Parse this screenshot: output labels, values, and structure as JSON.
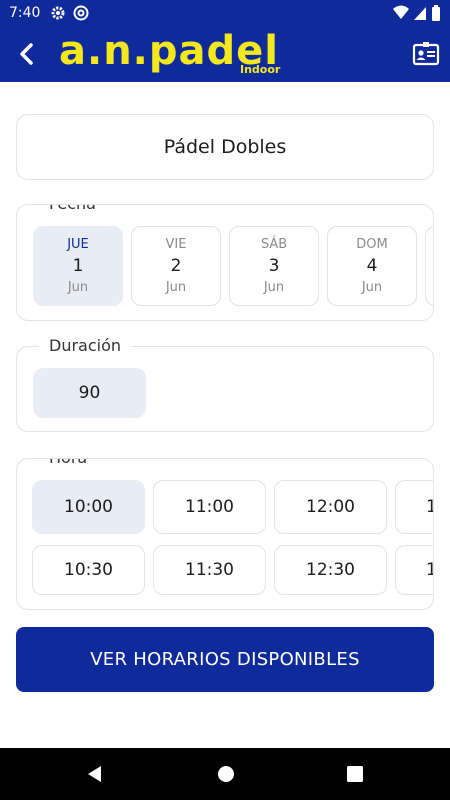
{
  "status_bar": {
    "time": "7:40",
    "icons": [
      "gear-icon",
      "at-icon",
      "wifi-icon",
      "signal-icon",
      "battery-icon"
    ]
  },
  "app_bar": {
    "logo_main": "a.n.padel",
    "logo_sub": "Indoor",
    "back_icon": "back-arrow-icon",
    "profile_icon": "id-card-icon",
    "color": "#0f2a9b",
    "accent": "#f4e81d"
  },
  "activity": {
    "name": "Pádel Dobles"
  },
  "fecha": {
    "label": "Fecha",
    "days": [
      {
        "name": "JUE",
        "day": "1",
        "month": "Jun",
        "selected": true
      },
      {
        "name": "VIE",
        "day": "2",
        "month": "Jun",
        "selected": false
      },
      {
        "name": "SÁB",
        "day": "3",
        "month": "Jun",
        "selected": false
      },
      {
        "name": "DOM",
        "day": "4",
        "month": "Jun",
        "selected": false
      }
    ]
  },
  "duracion": {
    "label": "Duración",
    "value": "90"
  },
  "hora": {
    "label": "Hora",
    "rows": [
      [
        "10:00",
        "11:00",
        "12:00",
        "1"
      ],
      [
        "10:30",
        "11:30",
        "12:30",
        "1"
      ]
    ],
    "selected": "10:00"
  },
  "cta": {
    "label": "VER HORARIOS DISPONIBLES"
  },
  "nav_bar": {
    "icons": [
      "back-triangle-icon",
      "home-circle-icon",
      "recents-square-icon"
    ]
  }
}
